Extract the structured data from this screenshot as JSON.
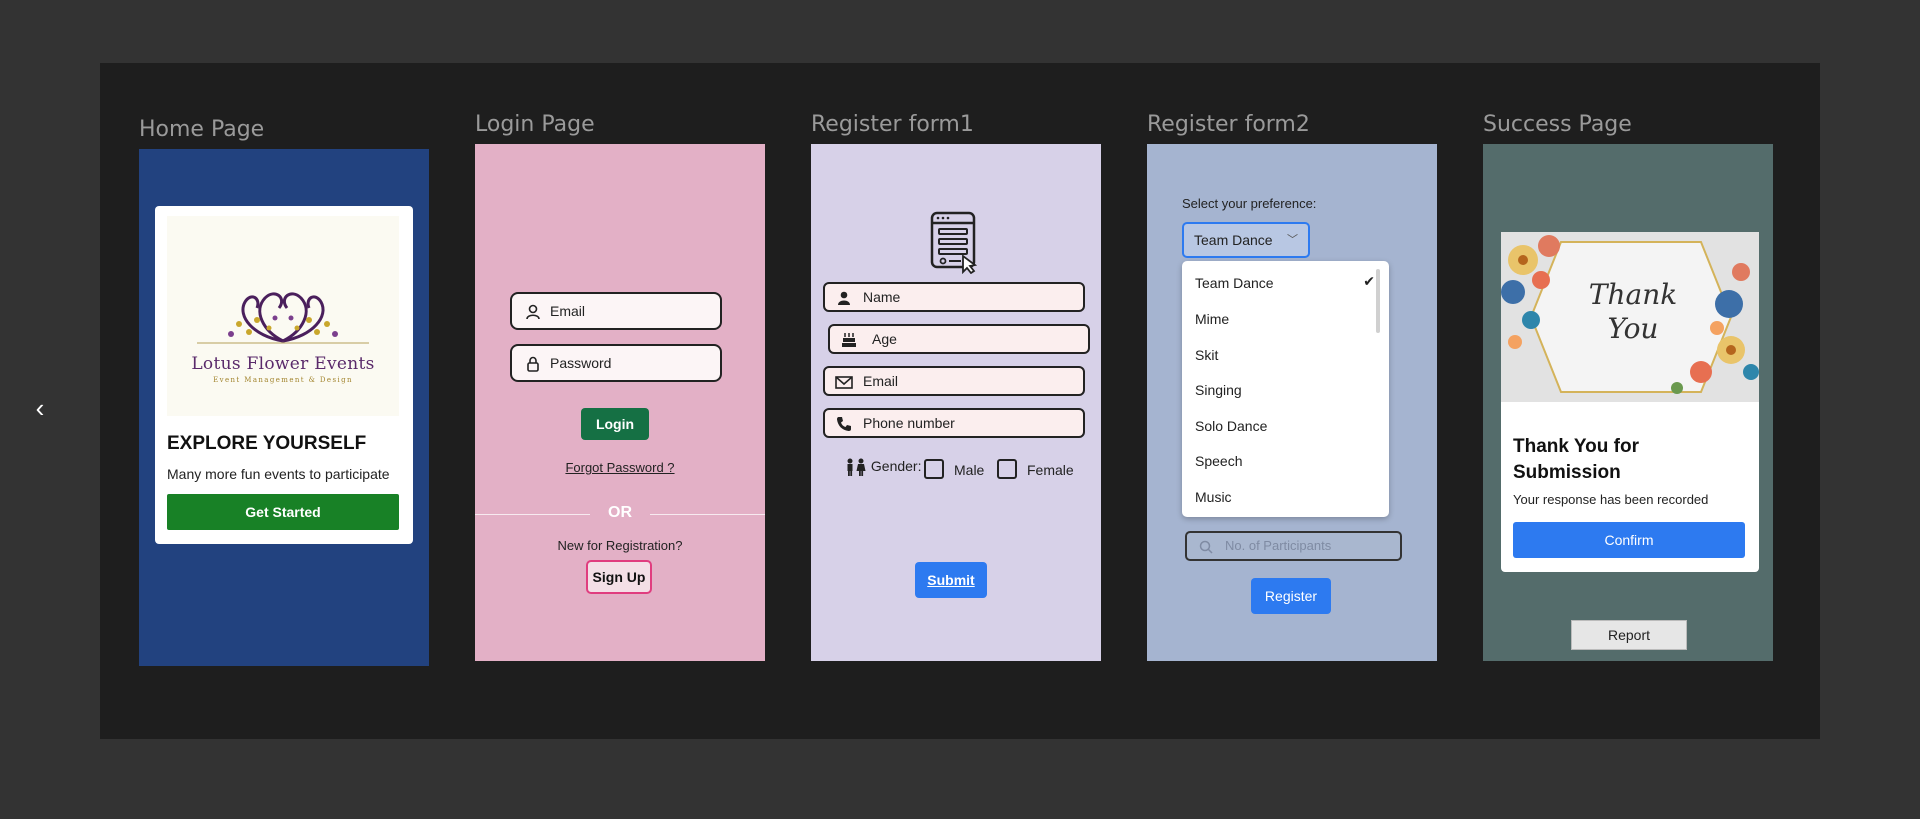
{
  "frames": {
    "home": "Home Page",
    "login": "Login Page",
    "register1": "Register form1",
    "register2": "Register form2",
    "success": "Success Page"
  },
  "home": {
    "logo_text": "Lotus Flower Events",
    "logo_sub": "Event Management & Design",
    "heading": "EXPLORE YOURSELF",
    "subtext": "Many more fun events to participate",
    "button": "Get Started"
  },
  "login": {
    "email_placeholder": "Email",
    "password_placeholder": "Password",
    "login_button": "Login",
    "forgot": "Forgot Password ?",
    "or": "OR",
    "new_registration": "New for Registration?",
    "signup_button": "Sign Up"
  },
  "register1": {
    "name": "Name",
    "age": "Age",
    "email": "Email",
    "phone": "Phone number",
    "gender_label": "Gender:",
    "male": "Male",
    "female": "Female",
    "submit": "Submit"
  },
  "register2": {
    "preference_label": "Select your preference:",
    "selected": "Team Dance",
    "options": [
      "Team Dance",
      "Mime",
      "Skit",
      "Singing",
      "Solo Dance",
      "Speech",
      "Music"
    ],
    "participants_placeholder": "No. of Participants",
    "register_button": "Register"
  },
  "success": {
    "image_text_1": "Thank",
    "image_text_2": "You",
    "heading": "Thank You for Submission",
    "subtext": "Your response has been recorded",
    "confirm_button": "Confirm",
    "report_button": "Report"
  },
  "colors": {
    "home_bg": "#22427f",
    "login_bg": "#e3b0c6",
    "register1_bg": "#d7d1e8",
    "register2_bg": "#a5b4d0",
    "success_bg": "#546c6b",
    "accent_blue": "#2d7af0",
    "green": "#188126"
  }
}
